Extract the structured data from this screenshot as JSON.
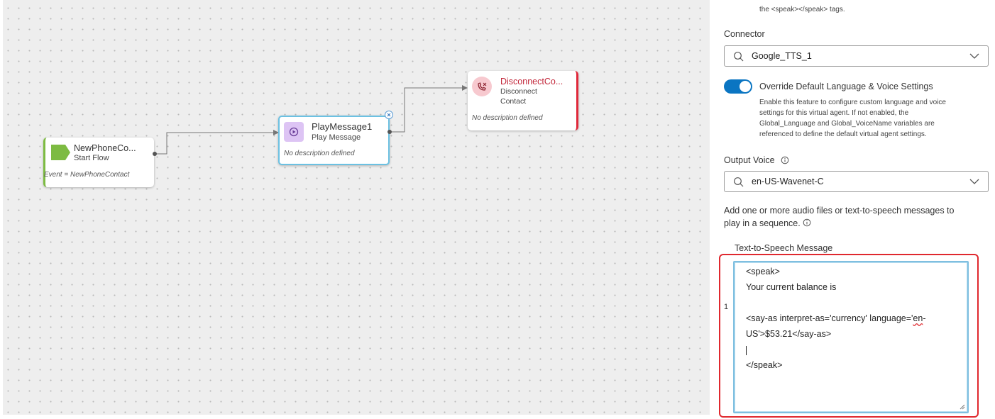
{
  "canvas": {
    "nodes": [
      {
        "title": "NewPhoneCo...",
        "subtitle": "Start Flow",
        "event": "Event = NewPhoneContact",
        "color": "#7dbb42"
      },
      {
        "title": "PlayMessage1",
        "subtitle": "Play Message",
        "description": "No description defined",
        "color": "#bb88e0"
      },
      {
        "title": "DisconnectCo...",
        "subtitle_line1": "Disconnect",
        "subtitle_line2": "Contact",
        "description": "No description defined",
        "color": "#e0283a"
      }
    ]
  },
  "panel": {
    "top_note": "the <speak></speak> tags.",
    "connector": {
      "label": "Connector",
      "value": "Google_TTS_1"
    },
    "override": {
      "label": "Override Default Language & Voice Settings",
      "enabled": true,
      "help": [
        "Enable this feature to configure custom language and voice",
        "settings for this virtual agent. If not enabled, the",
        "Global_Language and Global_VoiceName variables are",
        "referenced to define the default virtual agent settings."
      ]
    },
    "output_voice": {
      "label": "Output Voice",
      "value": "en-US-Wavenet-C"
    },
    "add_hint": {
      "line1": "Add one or more audio files or text-to-speech messages to",
      "line2": "play in a sequence."
    },
    "tts": {
      "label": "Text-to-Speech Message",
      "index": "1",
      "lines": {
        "l1": "<speak>",
        "l2": "Your current balance is",
        "l3a": "<say-as interpret-as='currency' language='",
        "l3b": "en",
        "l3c": "-",
        "l4": "US'>$53.21</say-as>",
        "l6": "</speak>"
      }
    }
  },
  "colors": {
    "accent": "#0a75c2",
    "highlight": "#e0282e"
  }
}
